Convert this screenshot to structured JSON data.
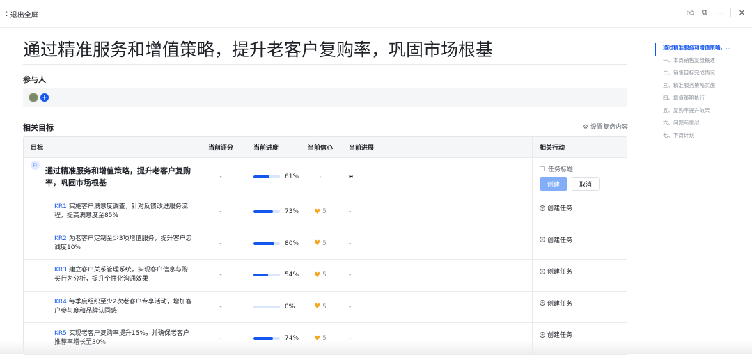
{
  "topbar": {
    "exit_label": "退出全屏",
    "exit_icon": "grid-dots-icon",
    "icons": [
      "thumbs-up-icon",
      "open-external-icon",
      "more-icon",
      "close-icon"
    ]
  },
  "title": "通过精准服务和增值策略，提升老客户复购率，巩固市场根基",
  "participants_label": "参与人",
  "related_label": "相关目标",
  "settings_link": "设置复盘内容",
  "table": {
    "headers": {
      "goal": "目标",
      "score": "当前评分",
      "progress": "当前进度",
      "confidence": "当前信心",
      "update": "当前进展",
      "actions": "相关行动"
    },
    "objective": {
      "text": "通过精准服务和增值策略，提升老客户复购率，巩固市场根基",
      "score": "-",
      "progress": 61,
      "progress_label": "61%",
      "confidence": "-",
      "update": "e"
    },
    "task_title_placeholder": "任务标题",
    "create_btn": "创建",
    "cancel_btn": "取消",
    "create_task_label": "创建任务",
    "krs": [
      {
        "tag": "KR1",
        "text": "实施客户满意度调查，针对反馈改进服务流程，提高满意度至85%",
        "score": "-",
        "progress": 73,
        "progress_label": "73%",
        "confidence": "5",
        "update": "-"
      },
      {
        "tag": "KR2",
        "text": "为老客户定制至少3项增值服务，提升客户忠诚度10%",
        "score": "-",
        "progress": 80,
        "progress_label": "80%",
        "confidence": "5",
        "update": "-"
      },
      {
        "tag": "KR3",
        "text": "建立客户关系管理系统，实现客户信息与购买行为分析，提升个性化沟通效果",
        "score": "-",
        "progress": 54,
        "progress_label": "54%",
        "confidence": "5",
        "update": "-"
      },
      {
        "tag": "KR4",
        "text": "每季度组织至少2次老客户专享活动，增加客户参与度和品牌认同感",
        "score": "-",
        "progress": 0,
        "progress_label": "0%",
        "confidence": "5",
        "update": "-"
      },
      {
        "tag": "KR5",
        "text": "实现老客户复购率提升15%，并确保老客户推荐率增长至30%",
        "score": "-",
        "progress": 74,
        "progress_label": "74%",
        "confidence": "5",
        "update": "-"
      }
    ]
  },
  "toc": [
    "通过精准服务和增值策略，提升老客户复购率，巩固市场根基",
    "一、本周销售复盘概述",
    "二、销售目标完成情况",
    "三、精准服务策略实施",
    "四、增值策略执行",
    "五、复购率提升效果",
    "六、问题与挑战",
    "七、下周计划"
  ],
  "colors": {
    "accent": "#1456f0",
    "heart": "#f5a623",
    "create_btn_bg": "#82aef9"
  }
}
